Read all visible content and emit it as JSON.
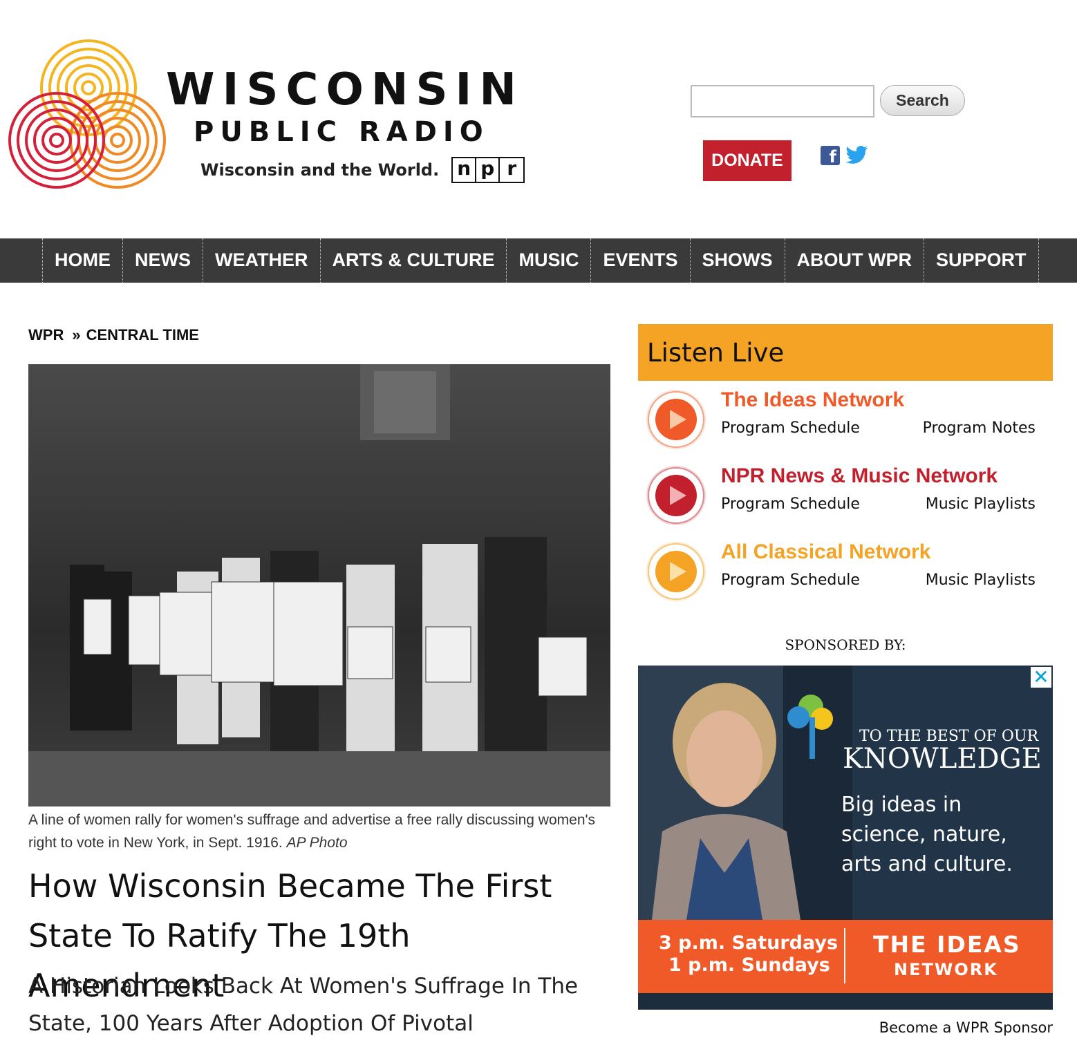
{
  "header": {
    "brand_line1": "WISCONSIN",
    "brand_line2": "PUBLIC RADIO",
    "tagline": "Wisconsin and the World.",
    "npr_letters": [
      "n",
      "p",
      "r"
    ],
    "search_placeholder": "",
    "search_label": "Search",
    "donate_label": "DONATE",
    "social": [
      "facebook-icon",
      "twitter-icon"
    ],
    "colors": {
      "donate": "#c3202e",
      "logo_orange": "#f08a24",
      "logo_red": "#d4213a",
      "logo_yellow": "#f4b520"
    }
  },
  "nav": {
    "items": [
      "HOME",
      "NEWS",
      "WEATHER",
      "ARTS & CULTURE",
      "MUSIC",
      "EVENTS",
      "SHOWS",
      "ABOUT WPR",
      "SUPPORT"
    ]
  },
  "breadcrumb": {
    "root": "WPR",
    "separator": "»",
    "current": "CENTRAL TIME"
  },
  "article": {
    "caption_text": "A line of women rally for women's suffrage and advertise a free rally discussing women's right to vote in New York, in Sept. 1916.",
    "caption_credit": "AP Photo",
    "headline": "How Wisconsin Became The First State To Ratify The 19th Amendment",
    "subhead": "A Historian Looks Back At Women's Suffrage In The State, 100 Years After Adoption Of Pivotal"
  },
  "listen_live": {
    "title": "Listen Live",
    "bar_color": "#f4a324",
    "stations": [
      {
        "name": "The Ideas Network",
        "color": "#f05a28",
        "link1": "Program Schedule",
        "link2": "Program Notes"
      },
      {
        "name": "NPR News & Music Network",
        "color": "#c3202e",
        "link1": "Program Schedule",
        "link2": "Music Playlists"
      },
      {
        "name": "All Classical Network",
        "color": "#f4a324",
        "link1": "Program Schedule",
        "link2": "Music Playlists"
      }
    ]
  },
  "sponsor": {
    "label": "SPONSORED BY:",
    "ad_close": "✕",
    "ad_show_line1": "TO THE BEST OF OUR",
    "ad_show_line2": "KNOWLEDGE",
    "ad_copy": "Big ideas in science, nature, arts and culture.",
    "ad_time1": "3 p.m. Saturdays",
    "ad_time2": "1 p.m. Sundays",
    "ad_network1": "THE IDEAS",
    "ad_network2": "NETWORK",
    "become_link": "Become a WPR Sponsor"
  }
}
